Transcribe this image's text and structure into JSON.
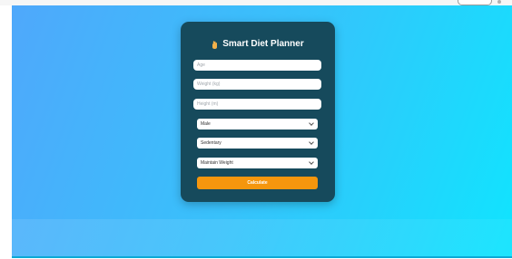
{
  "app": {
    "title": "Smart Diet Planner",
    "title_icon": "hand-icon"
  },
  "form": {
    "age_placeholder": "Age",
    "weight_placeholder": "Weight (kg)",
    "height_placeholder": "Height (m)",
    "gender_selected": "Male",
    "activity_selected": "Sedentary",
    "goal_selected": "Maintain Weight",
    "calculate_label": "Calculate"
  },
  "colors": {
    "background_start": "#4fa8fb",
    "background_end": "#10e4fe",
    "card": "#164a5c",
    "accent_button": "#f5960d"
  }
}
